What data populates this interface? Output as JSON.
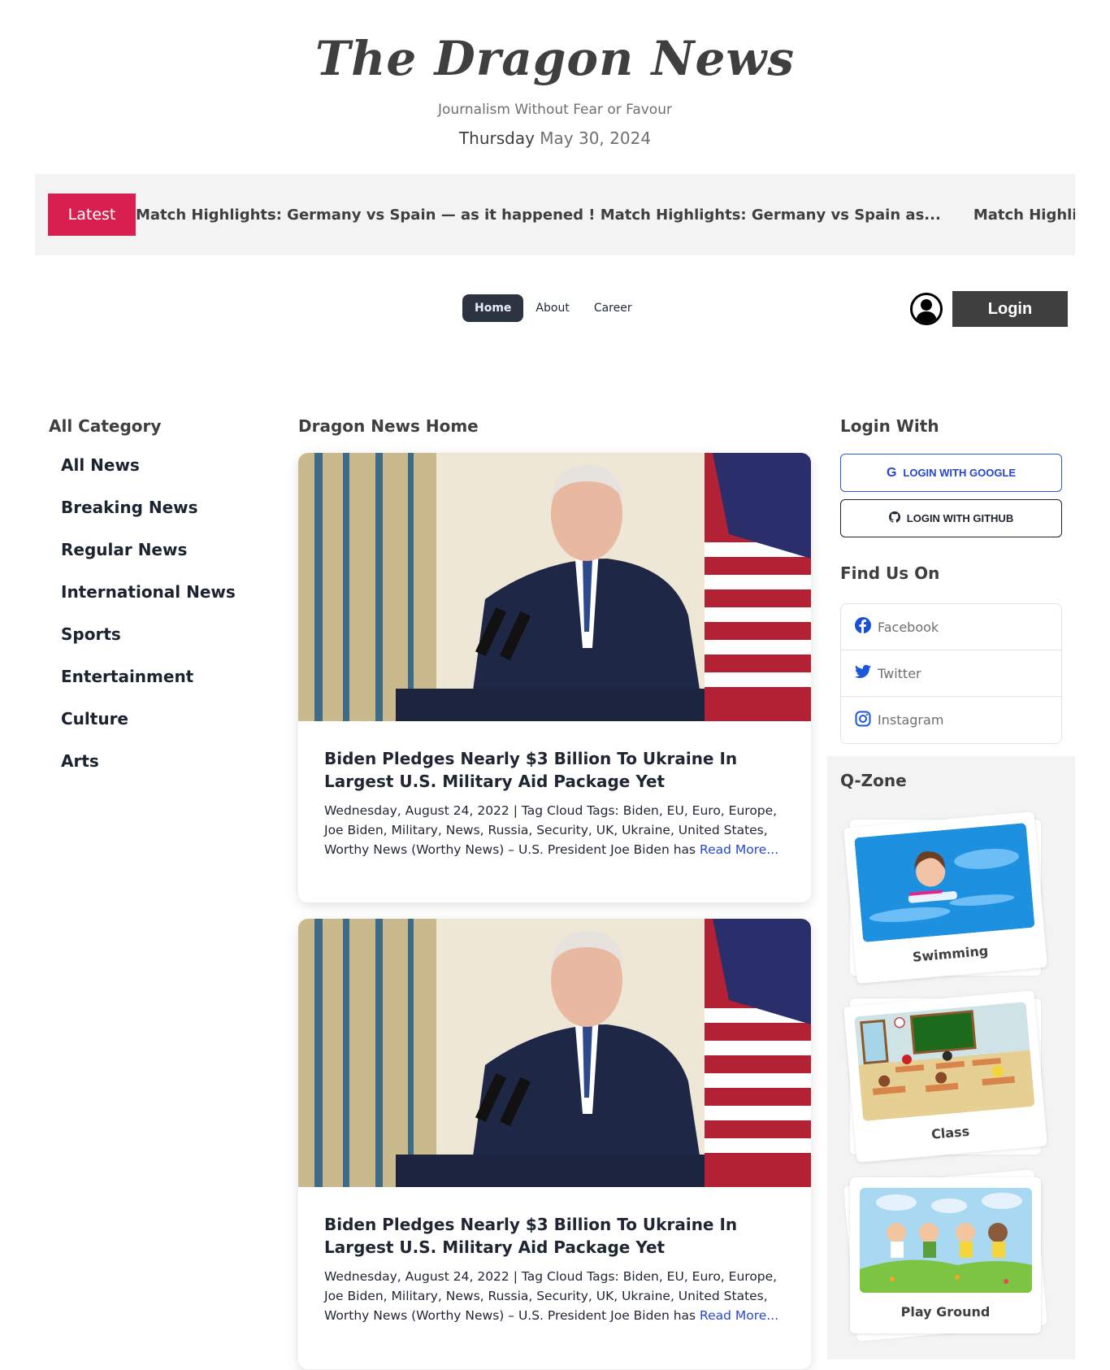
{
  "header": {
    "site_title": "The Dragon News",
    "tagline": "Journalism Without Fear or Favour",
    "day": "Thursday",
    "date": "May 30, 2024"
  },
  "ticker": {
    "badge_label": "Latest",
    "items": [
      "Match Highlights: Germany vs Spain — as it happened ! Match Highlights: Germany vs Spain as...",
      "Match Highlights: Germany vs Spain — as it happened ! Match Highlights: Germany vs Spain as..."
    ],
    "badge_color": "#D72050"
  },
  "nav": {
    "items": [
      {
        "label": "Home",
        "active": true
      },
      {
        "label": "About",
        "active": false
      },
      {
        "label": "Career",
        "active": false
      }
    ],
    "login_label": "Login",
    "user_icon": "user-avatar-icon"
  },
  "left_sidebar": {
    "heading": "All Category",
    "categories": [
      "All News",
      "Breaking News",
      "Regular News",
      "International News",
      "Sports",
      "Entertainment",
      "Culture",
      "Arts"
    ]
  },
  "main": {
    "heading": "Dragon News Home",
    "articles": [
      {
        "image_alt": "Joe Biden speaking at a podium with US flag",
        "title": "Biden Pledges Nearly $3 Billion To Ukraine In Largest U.S. Military Aid Package Yet",
        "excerpt": "Wednesday, August 24, 2022 | Tag Cloud Tags: Biden, EU, Euro, Europe, Joe Biden, Military, News, Russia, Security, UK, Ukraine, United States, Worthy News (Worthy News) – U.S. President Joe Biden has ",
        "read_more": "Read More..."
      },
      {
        "image_alt": "Joe Biden speaking at a podium with US flag",
        "title": "Biden Pledges Nearly $3 Billion To Ukraine In Largest U.S. Military Aid Package Yet",
        "excerpt": "Wednesday, August 24, 2022 | Tag Cloud Tags: Biden, EU, Euro, Europe, Joe Biden, Military, News, Russia, Security, UK, Ukraine, United States, Worthy News (Worthy News) – U.S. President Joe Biden has ",
        "read_more": "Read More..."
      }
    ]
  },
  "right_sidebar": {
    "login_heading": "Login With",
    "google_label": "LOGIN WITH GOOGLE",
    "github_label": "LOGIN WITH GITHUB",
    "find_heading": "Find Us On",
    "social": [
      {
        "label": "Facebook",
        "icon": "facebook-icon"
      },
      {
        "label": "Twitter",
        "icon": "twitter-icon"
      },
      {
        "label": "Instagram",
        "icon": "instagram-icon"
      }
    ],
    "qzone_heading": "Q-Zone",
    "qzone_items": [
      {
        "label": "Swimming"
      },
      {
        "label": "Class"
      },
      {
        "label": "Play Ground"
      }
    ]
  },
  "colors": {
    "accent_red": "#D72050",
    "dark": "#403F3F",
    "link_blue": "#2545d8",
    "panel_gray": "#F3F3F3"
  }
}
